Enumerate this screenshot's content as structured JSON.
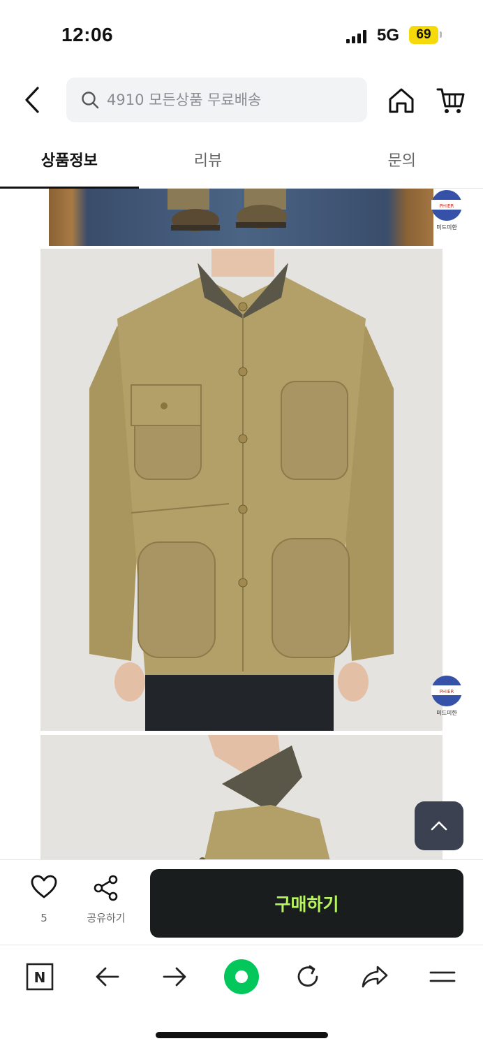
{
  "status_bar": {
    "time": "12:06",
    "network": "5G",
    "battery": "69",
    "battery_color": "#f5d90a"
  },
  "header": {
    "search_placeholder": "4910 모든상품 무료배송",
    "icons": [
      "back-icon",
      "search-icon",
      "home-icon",
      "cart-icon"
    ]
  },
  "tabs": [
    {
      "label": "상품정보",
      "active": true
    },
    {
      "label": "리뷰",
      "active": false
    },
    {
      "label": "문의",
      "active": false
    }
  ],
  "content": {
    "images": [
      {
        "name": "product-photo-legs-shoes"
      },
      {
        "name": "product-photo-jacket-front"
      },
      {
        "name": "product-photo-jacket-side"
      }
    ],
    "watermark_text": "미드미한",
    "logo_text": "PHIER"
  },
  "action_bar": {
    "like_count": "5",
    "share_label": "공유하기",
    "buy_label": "구매하기",
    "buy_bg": "#1a1d1e",
    "buy_text_color": "#b7f55c"
  },
  "browser_toolbar": {
    "items": [
      "naver-icon",
      "back-arrow-icon",
      "forward-arrow-icon",
      "green-dot-icon",
      "refresh-icon",
      "share-arrow-icon",
      "menu-icon"
    ],
    "accent": "#03c75a"
  }
}
